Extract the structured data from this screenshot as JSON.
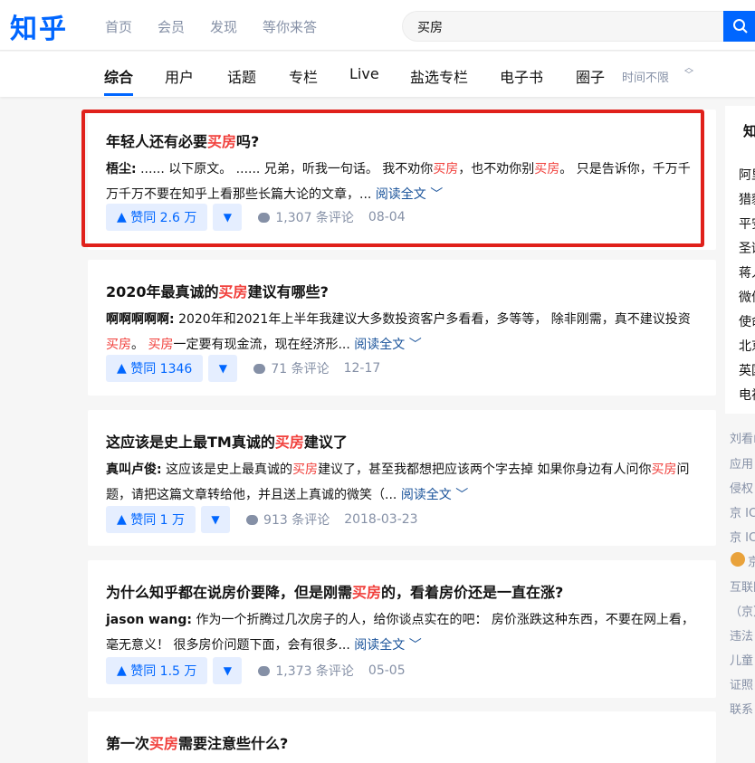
{
  "header": {
    "logo": "知乎",
    "nav": [
      "首页",
      "会员",
      "发现",
      "等你来答"
    ],
    "search_value": "买房"
  },
  "tabs": {
    "items": [
      "综合",
      "用户",
      "话题",
      "专栏",
      "Live",
      "盐选专栏",
      "电子书",
      "圈子"
    ],
    "active": "综合",
    "time_filter": "时间不限"
  },
  "results": [
    {
      "title_pre": "年轻人还有必要",
      "title_hl": "买房",
      "title_post": "吗?",
      "author": "梧尘:",
      "excerpt": [
        {
          "t": "...... 以下原文。 ...... 兄弟，听我一句话。 我不劝你",
          "h": false
        },
        {
          "t": "买房",
          "h": true
        },
        {
          "t": "，也不劝你别",
          "h": false
        },
        {
          "t": "买房",
          "h": true
        },
        {
          "t": "。 只是告诉你，千万千万千万不要在知乎上看那些长篇大论的文章，... ",
          "h": false
        }
      ],
      "read_more": "阅读全文",
      "votes": "赞同 2.6 万",
      "comments": "1,307 条评论",
      "date": "08-04"
    },
    {
      "title_pre": "2020年最真诚的",
      "title_hl": "买房",
      "title_post": "建议有哪些?",
      "author": "啊啊啊啊啊:",
      "excerpt": [
        {
          "t": "2020年和2021年上半年我建议大多数投资客户多看看，多等等， 除非刚需，真不建议投资",
          "h": false
        },
        {
          "t": "买房",
          "h": true
        },
        {
          "t": "。 ",
          "h": false
        },
        {
          "t": "买房",
          "h": true
        },
        {
          "t": "一定要有现金流，现在经济形... ",
          "h": false
        }
      ],
      "read_more": "阅读全文",
      "votes": "赞同 1346",
      "comments": "71 条评论",
      "date": "12-17"
    },
    {
      "title_pre": "这应该是史上最TM真诚的",
      "title_hl": "买房",
      "title_post": "建议了",
      "author": "真叫卢俊:",
      "excerpt": [
        {
          "t": "这应该是史上最真诚的",
          "h": false
        },
        {
          "t": "买房",
          "h": true
        },
        {
          "t": "建议了，甚至我都想把应该两个字去掉 如果你身边有人问你",
          "h": false
        },
        {
          "t": "买房",
          "h": true
        },
        {
          "t": "问题，请把这篇文章转给他，并且送上真诚的微笑（... ",
          "h": false
        }
      ],
      "read_more": "阅读全文",
      "votes": "赞同 1 万",
      "comments": "913 条评论",
      "date": "2018-03-23"
    },
    {
      "title_pre": "为什么知乎都在说房价要降，但是刚需",
      "title_hl": "买房",
      "title_post": "的，看着房价还是一直在涨?",
      "author": "jason wang:",
      "excerpt": [
        {
          "t": "作为一个折腾过几次房子的人，给你谈点实在的吧： 房价涨跌这种东西，不要在网上看，毫无意义！ 很多房价问题下面，会有很多... ",
          "h": false
        }
      ],
      "read_more": "阅读全文",
      "votes": "赞同 1.5 万",
      "comments": "1,373 条评论",
      "date": "05-05"
    },
    {
      "title_pre": "第一次",
      "title_hl": "买房",
      "title_post": "需要注意些什么?"
    }
  ],
  "sidebar": {
    "title": "知",
    "items": [
      "阿里",
      "猎豹",
      "平安",
      "圣诞",
      "蒋人",
      "微信",
      "使命",
      "北京",
      "英国",
      "电视"
    ],
    "footer": [
      "刘看山",
      "应用",
      "侵权",
      "京 IC",
      "京 IC",
      "京",
      "互联网",
      "（京）",
      "违法",
      "儿童",
      "证照",
      "联系"
    ]
  },
  "colors": {
    "brand": "#0066ff",
    "keyword_highlight": "#f1403c",
    "annotation_box": "#e0211b"
  }
}
